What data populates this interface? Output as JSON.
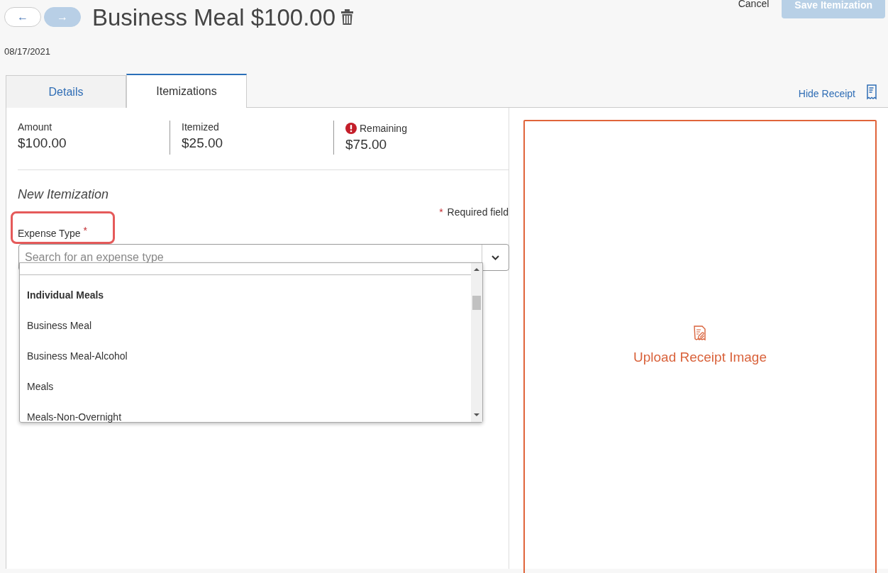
{
  "header": {
    "back_button": {
      "label": "←",
      "disabled": false
    },
    "forward_button": {
      "label": "→",
      "disabled": true
    },
    "title": "Business Meal $100.00",
    "cancel": "Cancel",
    "save_button": {
      "label": "Save Itemization",
      "disabled": true
    }
  },
  "date": "08/17/2021",
  "tabs": [
    {
      "label": "Details",
      "selected": false
    },
    {
      "label": "Itemizations",
      "selected": true
    }
  ],
  "hide_receipt": "Hide Receipt",
  "summary": [
    {
      "label": "Amount",
      "value": "$100.00",
      "alert": false
    },
    {
      "label": "Itemized",
      "value": "$25.00",
      "alert": false
    },
    {
      "label": "Remaining",
      "value": "$75.00",
      "alert": true
    }
  ],
  "form": {
    "heading": "New Itemization",
    "required_note": {
      "mark": "*",
      "text": "Required field"
    },
    "expense_type": {
      "label": "Expense Type",
      "required_mark": "*",
      "highlighted": true,
      "placeholder": "Search for an expense type",
      "expanded": true
    },
    "options": [
      {
        "kind": "group",
        "label": "Individual Meals"
      },
      {
        "kind": "option",
        "label": "Business Meal"
      },
      {
        "kind": "option",
        "label": "Business Meal-Alcohol"
      },
      {
        "kind": "option",
        "label": "Meals"
      },
      {
        "kind": "option",
        "label": "Meals-Non-Overnight"
      }
    ]
  },
  "receipt": {
    "upload_label": "Upload Receipt Image"
  }
}
